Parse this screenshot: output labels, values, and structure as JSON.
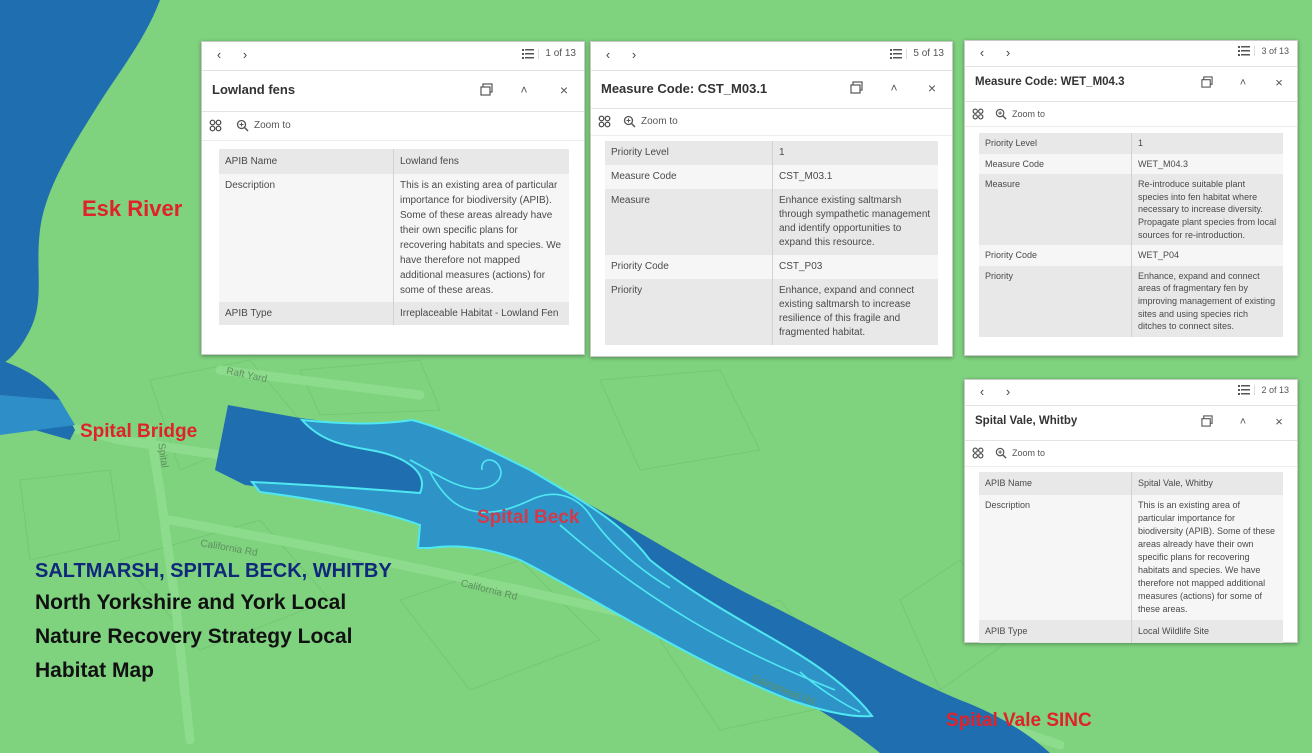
{
  "map_labels": {
    "esk_river": "Esk River",
    "spital_bridge": "Spital Bridge",
    "spital_beck": "Spital Beck",
    "spital_vale_sinc": "Spital Vale SINC",
    "heading": "SALTMARSH, SPITAL BECK, WHITBY",
    "subtitle_line1": "North Yorkshire and York Local",
    "subtitle_line2": "Nature Recovery Strategy Local",
    "subtitle_line3": "Habitat Map"
  },
  "road_labels": {
    "raft_yard": "Raft Yard",
    "california_rd_1": "California Rd",
    "california_rd_2": "California Rd",
    "spital_rd": "Spital",
    "stream_label": "Gainsmead Rd"
  },
  "colors": {
    "land": "#7fd37f",
    "water": "#1f6fb0",
    "habitat_fill": "#2e94c8",
    "habitat_outline": "#4fe8f2",
    "label_red": "#e0222a",
    "heading_navy": "#10287a"
  },
  "icons": {
    "prev": "chevron-left-icon",
    "next": "chevron-right-icon",
    "list": "list-icon",
    "dock": "dock-icon",
    "collapse": "chevron-up-icon",
    "close": "close-icon",
    "actions": "grid-dots-icon",
    "zoom": "zoom-in-icon"
  },
  "popups": {
    "lowland_fens": {
      "pager": "1 of 13",
      "title": "Lowland fens",
      "zoom_label": "Zoom to",
      "rows": [
        {
          "key": "APIB Name",
          "value": "Lowland fens"
        },
        {
          "key": "Description",
          "value": "This is an existing area of particular importance for biodiversity (APIB). Some of these areas already have their own specific plans for recovering habitats and species. We have therefore not mapped additional measures (actions) for some of these areas."
        },
        {
          "key": "APIB Type",
          "value": "Irreplaceable Habitat - Lowland Fen"
        }
      ]
    },
    "cst_m03": {
      "pager": "5 of 13",
      "title": "Measure Code: CST_M03.1",
      "zoom_label": "Zoom to",
      "rows": [
        {
          "key": "Priority Level",
          "value": "1"
        },
        {
          "key": "Measure Code",
          "value": "CST_M03.1"
        },
        {
          "key": "Measure",
          "value": "Enhance existing saltmarsh through sympathetic management and identify opportunities to expand this resource."
        },
        {
          "key": "Priority Code",
          "value": "CST_P03"
        },
        {
          "key": "Priority",
          "value": "Enhance, expand and connect existing saltmarsh to increase resilience of this fragile and fragmented habitat."
        }
      ]
    },
    "wet_m04": {
      "pager": "3 of 13",
      "title": "Measure Code: WET_M04.3",
      "zoom_label": "Zoom to",
      "rows": [
        {
          "key": "Priority Level",
          "value": "1"
        },
        {
          "key": "Measure Code",
          "value": "WET_M04.3"
        },
        {
          "key": "Measure",
          "value": "Re-introduce suitable plant species into fen habitat where necessary to increase diversity. Propagate plant species from local sources for re-introduction."
        },
        {
          "key": "Priority Code",
          "value": "WET_P04"
        },
        {
          "key": "Priority",
          "value": "Enhance, expand and connect areas of fragmentary fen by improving management of existing sites and using species rich ditches to connect sites."
        }
      ]
    },
    "spital_vale": {
      "pager": "2 of 13",
      "title": "Spital Vale, Whitby",
      "zoom_label": "Zoom to",
      "rows": [
        {
          "key": "APIB Name",
          "value": "Spital Vale, Whitby"
        },
        {
          "key": "Description",
          "value": "This is an existing area of particular importance for biodiversity (APIB). Some of these areas already have their own specific plans for recovering habitats and species. We have therefore not mapped additional measures (actions) for some of these areas."
        },
        {
          "key": "APIB Type",
          "value": "Local Wildlife Site"
        }
      ]
    }
  }
}
